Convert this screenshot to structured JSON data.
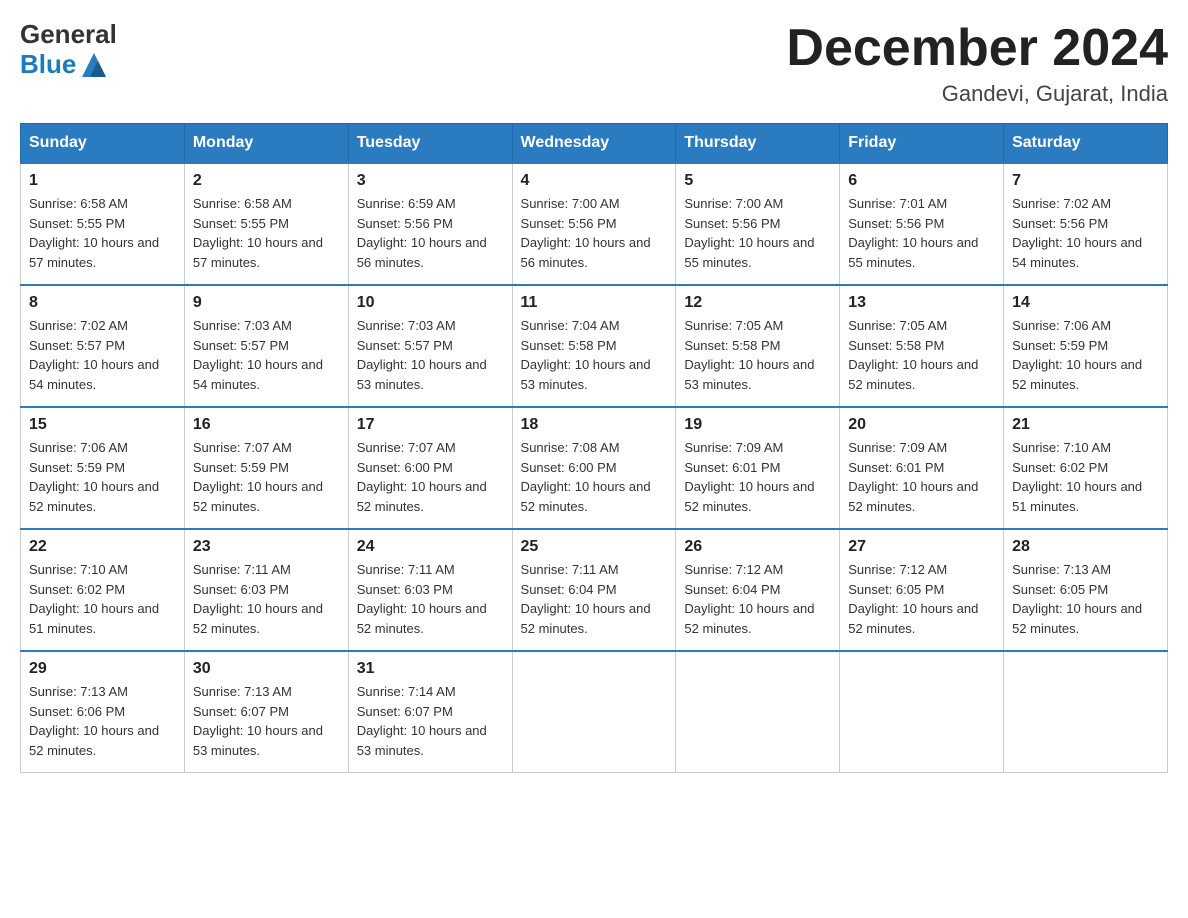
{
  "header": {
    "logo_general": "General",
    "logo_blue": "Blue",
    "month_title": "December 2024",
    "location": "Gandevi, Gujarat, India"
  },
  "days_of_week": [
    "Sunday",
    "Monday",
    "Tuesday",
    "Wednesday",
    "Thursday",
    "Friday",
    "Saturday"
  ],
  "weeks": [
    [
      {
        "day": "1",
        "sunrise": "6:58 AM",
        "sunset": "5:55 PM",
        "daylight": "10 hours and 57 minutes."
      },
      {
        "day": "2",
        "sunrise": "6:58 AM",
        "sunset": "5:55 PM",
        "daylight": "10 hours and 57 minutes."
      },
      {
        "day": "3",
        "sunrise": "6:59 AM",
        "sunset": "5:56 PM",
        "daylight": "10 hours and 56 minutes."
      },
      {
        "day": "4",
        "sunrise": "7:00 AM",
        "sunset": "5:56 PM",
        "daylight": "10 hours and 56 minutes."
      },
      {
        "day": "5",
        "sunrise": "7:00 AM",
        "sunset": "5:56 PM",
        "daylight": "10 hours and 55 minutes."
      },
      {
        "day": "6",
        "sunrise": "7:01 AM",
        "sunset": "5:56 PM",
        "daylight": "10 hours and 55 minutes."
      },
      {
        "day": "7",
        "sunrise": "7:02 AM",
        "sunset": "5:56 PM",
        "daylight": "10 hours and 54 minutes."
      }
    ],
    [
      {
        "day": "8",
        "sunrise": "7:02 AM",
        "sunset": "5:57 PM",
        "daylight": "10 hours and 54 minutes."
      },
      {
        "day": "9",
        "sunrise": "7:03 AM",
        "sunset": "5:57 PM",
        "daylight": "10 hours and 54 minutes."
      },
      {
        "day": "10",
        "sunrise": "7:03 AM",
        "sunset": "5:57 PM",
        "daylight": "10 hours and 53 minutes."
      },
      {
        "day": "11",
        "sunrise": "7:04 AM",
        "sunset": "5:58 PM",
        "daylight": "10 hours and 53 minutes."
      },
      {
        "day": "12",
        "sunrise": "7:05 AM",
        "sunset": "5:58 PM",
        "daylight": "10 hours and 53 minutes."
      },
      {
        "day": "13",
        "sunrise": "7:05 AM",
        "sunset": "5:58 PM",
        "daylight": "10 hours and 52 minutes."
      },
      {
        "day": "14",
        "sunrise": "7:06 AM",
        "sunset": "5:59 PM",
        "daylight": "10 hours and 52 minutes."
      }
    ],
    [
      {
        "day": "15",
        "sunrise": "7:06 AM",
        "sunset": "5:59 PM",
        "daylight": "10 hours and 52 minutes."
      },
      {
        "day": "16",
        "sunrise": "7:07 AM",
        "sunset": "5:59 PM",
        "daylight": "10 hours and 52 minutes."
      },
      {
        "day": "17",
        "sunrise": "7:07 AM",
        "sunset": "6:00 PM",
        "daylight": "10 hours and 52 minutes."
      },
      {
        "day": "18",
        "sunrise": "7:08 AM",
        "sunset": "6:00 PM",
        "daylight": "10 hours and 52 minutes."
      },
      {
        "day": "19",
        "sunrise": "7:09 AM",
        "sunset": "6:01 PM",
        "daylight": "10 hours and 52 minutes."
      },
      {
        "day": "20",
        "sunrise": "7:09 AM",
        "sunset": "6:01 PM",
        "daylight": "10 hours and 52 minutes."
      },
      {
        "day": "21",
        "sunrise": "7:10 AM",
        "sunset": "6:02 PM",
        "daylight": "10 hours and 51 minutes."
      }
    ],
    [
      {
        "day": "22",
        "sunrise": "7:10 AM",
        "sunset": "6:02 PM",
        "daylight": "10 hours and 51 minutes."
      },
      {
        "day": "23",
        "sunrise": "7:11 AM",
        "sunset": "6:03 PM",
        "daylight": "10 hours and 52 minutes."
      },
      {
        "day": "24",
        "sunrise": "7:11 AM",
        "sunset": "6:03 PM",
        "daylight": "10 hours and 52 minutes."
      },
      {
        "day": "25",
        "sunrise": "7:11 AM",
        "sunset": "6:04 PM",
        "daylight": "10 hours and 52 minutes."
      },
      {
        "day": "26",
        "sunrise": "7:12 AM",
        "sunset": "6:04 PM",
        "daylight": "10 hours and 52 minutes."
      },
      {
        "day": "27",
        "sunrise": "7:12 AM",
        "sunset": "6:05 PM",
        "daylight": "10 hours and 52 minutes."
      },
      {
        "day": "28",
        "sunrise": "7:13 AM",
        "sunset": "6:05 PM",
        "daylight": "10 hours and 52 minutes."
      }
    ],
    [
      {
        "day": "29",
        "sunrise": "7:13 AM",
        "sunset": "6:06 PM",
        "daylight": "10 hours and 52 minutes."
      },
      {
        "day": "30",
        "sunrise": "7:13 AM",
        "sunset": "6:07 PM",
        "daylight": "10 hours and 53 minutes."
      },
      {
        "day": "31",
        "sunrise": "7:14 AM",
        "sunset": "6:07 PM",
        "daylight": "10 hours and 53 minutes."
      },
      null,
      null,
      null,
      null
    ]
  ]
}
